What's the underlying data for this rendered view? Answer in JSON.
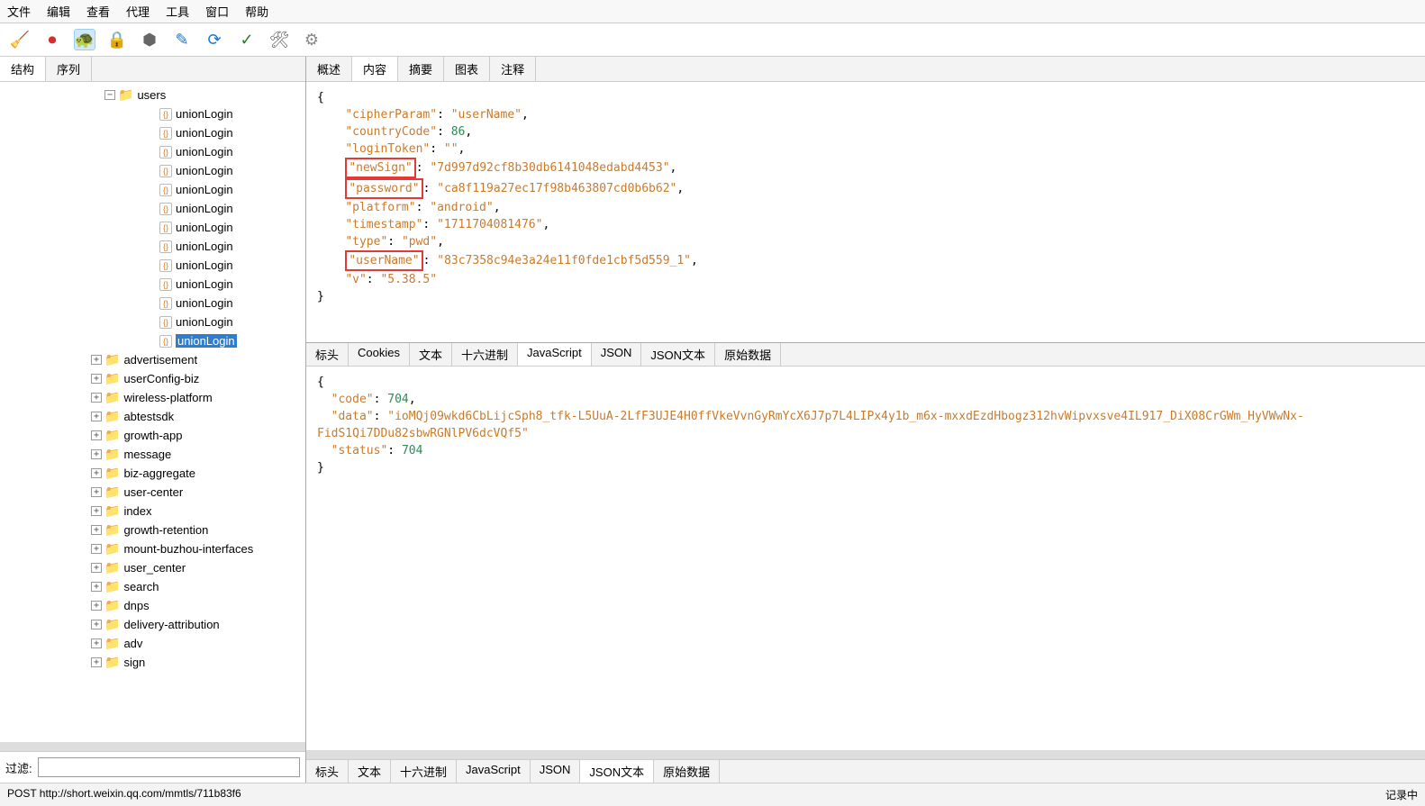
{
  "menu": [
    "文件",
    "编辑",
    "查看",
    "代理",
    "工具",
    "窗口",
    "帮助"
  ],
  "toolbar_icons": [
    {
      "name": "broom-icon",
      "glyph": "🧹",
      "active": false
    },
    {
      "name": "record-icon",
      "glyph": "⏺",
      "active": false,
      "color": "#d32f2f"
    },
    {
      "name": "throttle-icon",
      "glyph": "🐢",
      "active": true
    },
    {
      "name": "lock-icon",
      "glyph": "🔒",
      "active": false,
      "color": "#666"
    },
    {
      "name": "hex-icon",
      "glyph": "⬢",
      "active": false,
      "color": "#666"
    },
    {
      "name": "edit-icon",
      "glyph": "✎",
      "active": false,
      "color": "#1976d2"
    },
    {
      "name": "refresh-icon",
      "glyph": "⟳",
      "active": false,
      "color": "#1976d2"
    },
    {
      "name": "check-icon",
      "glyph": "✓",
      "active": false,
      "color": "#2e7d32"
    },
    {
      "name": "tools-icon",
      "glyph": "🛠",
      "active": false,
      "color": "#666"
    },
    {
      "name": "gear-icon",
      "glyph": "⚙",
      "active": false,
      "color": "#888"
    }
  ],
  "left_tabs": {
    "items": [
      "结构",
      "序列"
    ],
    "active": 0
  },
  "tree": {
    "root": {
      "label": "users",
      "expanded": true,
      "indent": 110
    },
    "children_count": 13,
    "child_label": "unionLogin",
    "selected_index": 12,
    "child_indent": 155,
    "folders": [
      "advertisement",
      "userConfig-biz",
      "wireless-platform",
      "abtestsdk",
      "growth-app",
      "message",
      "biz-aggregate",
      "user-center",
      "index",
      "growth-retention",
      "mount-buzhou-interfaces",
      "user_center",
      "search",
      "dnps",
      "delivery-attribution",
      "adv",
      "sign"
    ],
    "folder_indent": 95
  },
  "filter_label": "过滤:",
  "top_tabs": {
    "items": [
      "概述",
      "内容",
      "摘要",
      "图表",
      "注释"
    ],
    "active": 1
  },
  "req_subtabs": {
    "items": [
      "标头",
      "Cookies",
      "文本",
      "十六进制",
      "JavaScript",
      "JSON",
      "JSON文本",
      "原始数据"
    ],
    "active": 4
  },
  "res_subtabs": {
    "items": [
      "标头",
      "文本",
      "十六进制",
      "JavaScript",
      "JSON",
      "JSON文本",
      "原始数据"
    ],
    "active": 5
  },
  "request_json": {
    "cipherParam": "userName",
    "countryCode": 86,
    "loginToken": "",
    "newSign": "7d997d92cf8b30db6141048edabd4453",
    "password": "ca8f119a27ec17f98b463807cd0b6b62",
    "platform": "android",
    "timestamp": "1711704081476",
    "type": "pwd",
    "userName": "83c7358c94e3a24e11f0fde1cbf5d559_1",
    "v": "5.38.5"
  },
  "highlighted_keys": [
    "newSign",
    "password",
    "userName"
  ],
  "response_json": {
    "code": 704,
    "data": "ioMQj09wkd6CbLijcSph8_tfk-L5UuA-2LfF3UJE4H0ffVkeVvnGyRmYcX6J7p7L4LIPx4y1b_m6x-mxxdEzdHbogz312hvWipvxsve4IL917_DiX08CrGWm_HyVWwNx-FidS1Qi7DDu82sbwRGNlPV6dcVQf5",
    "status": 704
  },
  "status_left": "POST http://short.weixin.qq.com/mmtls/711b83f6",
  "status_right": "记录中"
}
